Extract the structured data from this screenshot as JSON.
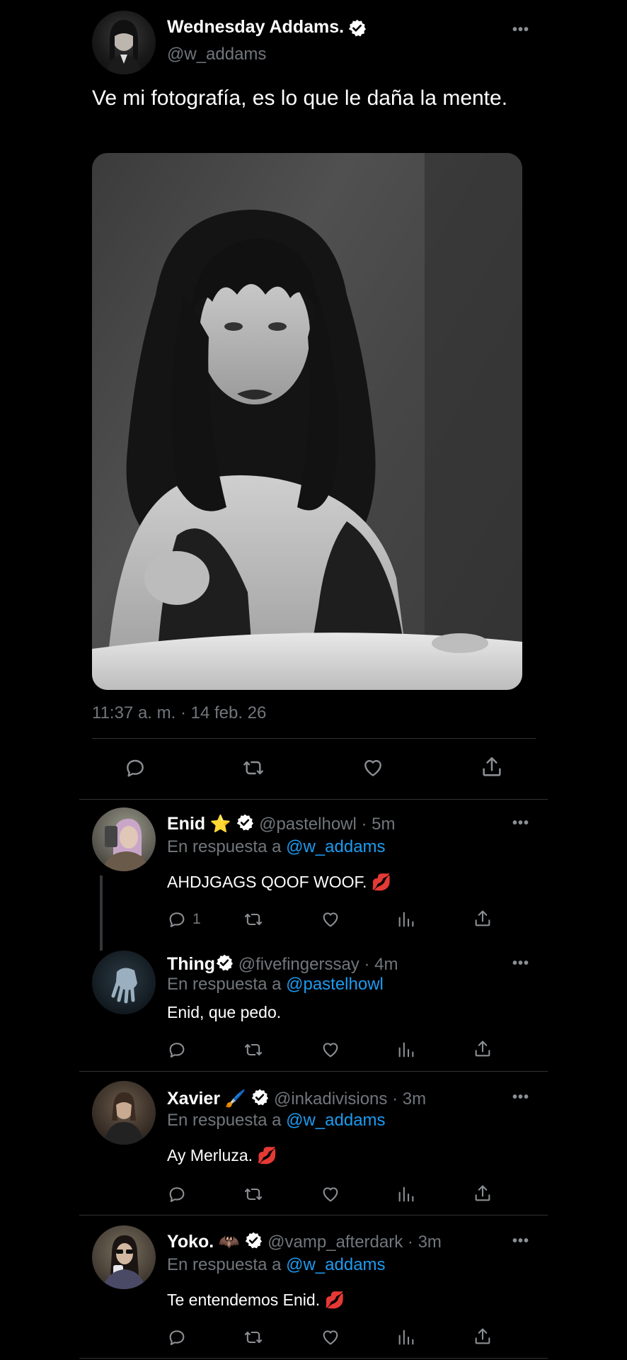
{
  "main_tweet": {
    "author": "Wednesday Addams.",
    "handle": "@w_addams",
    "text": "Ve mi fotografía, es lo que le daña la mente.",
    "timestamp": "11:37 a. m. · 14 feb. 26",
    "menu": "•••",
    "actions": [
      "reply-icon",
      "retweet-icon",
      "like-icon",
      "share-icon"
    ]
  },
  "replies": [
    {
      "name": "Enid",
      "emoji": "⭐",
      "handle": "@pastelhowl",
      "time": "· 5m",
      "reply_prefix": "En respuesta a",
      "reply_to": "@w_addams",
      "text": "AHDJGAGS QOOF WOOF. 💋",
      "reply_count": "1",
      "menu": "•••"
    },
    {
      "name": "Thing",
      "emoji": "",
      "handle": "@fivefingerssay",
      "time": "· 4m",
      "reply_prefix": "En respuesta a",
      "reply_to": "@pastelhowl",
      "text": "Enid, que pedo.",
      "reply_count": "",
      "menu": "•••"
    },
    {
      "name": "Xavier",
      "emoji": "🖌️",
      "handle": "@inkadivisions",
      "time": "· 3m",
      "reply_prefix": "En respuesta a",
      "reply_to": "@w_addams",
      "text": "Ay Merluza. 💋",
      "reply_count": "",
      "menu": "•••"
    },
    {
      "name": "Yoko.",
      "emoji": "🦇",
      "handle": "@vamp_afterdark",
      "time": "· 3m",
      "reply_prefix": "En respuesta a",
      "reply_to": "@w_addams",
      "text": "Te entendemos Enid. 💋",
      "reply_count": "",
      "menu": "•••"
    }
  ],
  "colors": {
    "background": "#000000",
    "link": "#1d9bf0",
    "secondary_text": "#71767b",
    "verified": "#ffffff"
  }
}
